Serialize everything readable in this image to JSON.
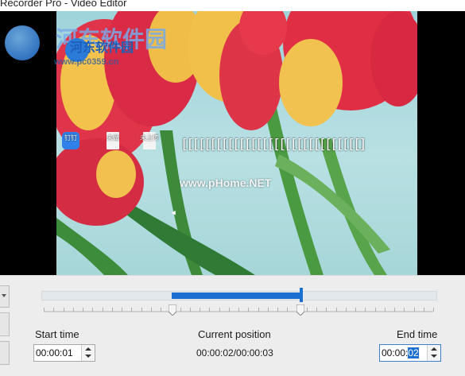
{
  "window": {
    "title": "Recorder Pro - Video Editor"
  },
  "preview": {
    "desktop_icons": [
      {
        "label": "钉钉",
        "icon": "dingtalk-icon",
        "color": "#2f80e8"
      },
      {
        "label": "未做",
        "icon": "file-icon",
        "color": "#f3f3f3"
      },
      {
        "label": "未上传",
        "icon": "file-icon",
        "color": "#f3f3f3"
      }
    ],
    "garbled_text": "[[[[[[[[[[[[[[[[[[[[[[[[[[[[[[[]",
    "watermark": "www.pHome.NET"
  },
  "logo": {
    "big_text": "河东软件园",
    "small_text": "河东软件园",
    "url": "www.pc0359.cn",
    "color": "#1d5fb8"
  },
  "timeline": {
    "selection_start_fraction": 0.33,
    "selection_end_fraction": 0.66,
    "accent_color": "#1a6fd1"
  },
  "start_time": {
    "label": "Start time",
    "value": "00:00:01"
  },
  "current_position": {
    "label": "Current position",
    "value": "00:00:02/00:00:03"
  },
  "end_time": {
    "label": "End time",
    "value_prefix": "00:00:",
    "value_selected": "02"
  }
}
